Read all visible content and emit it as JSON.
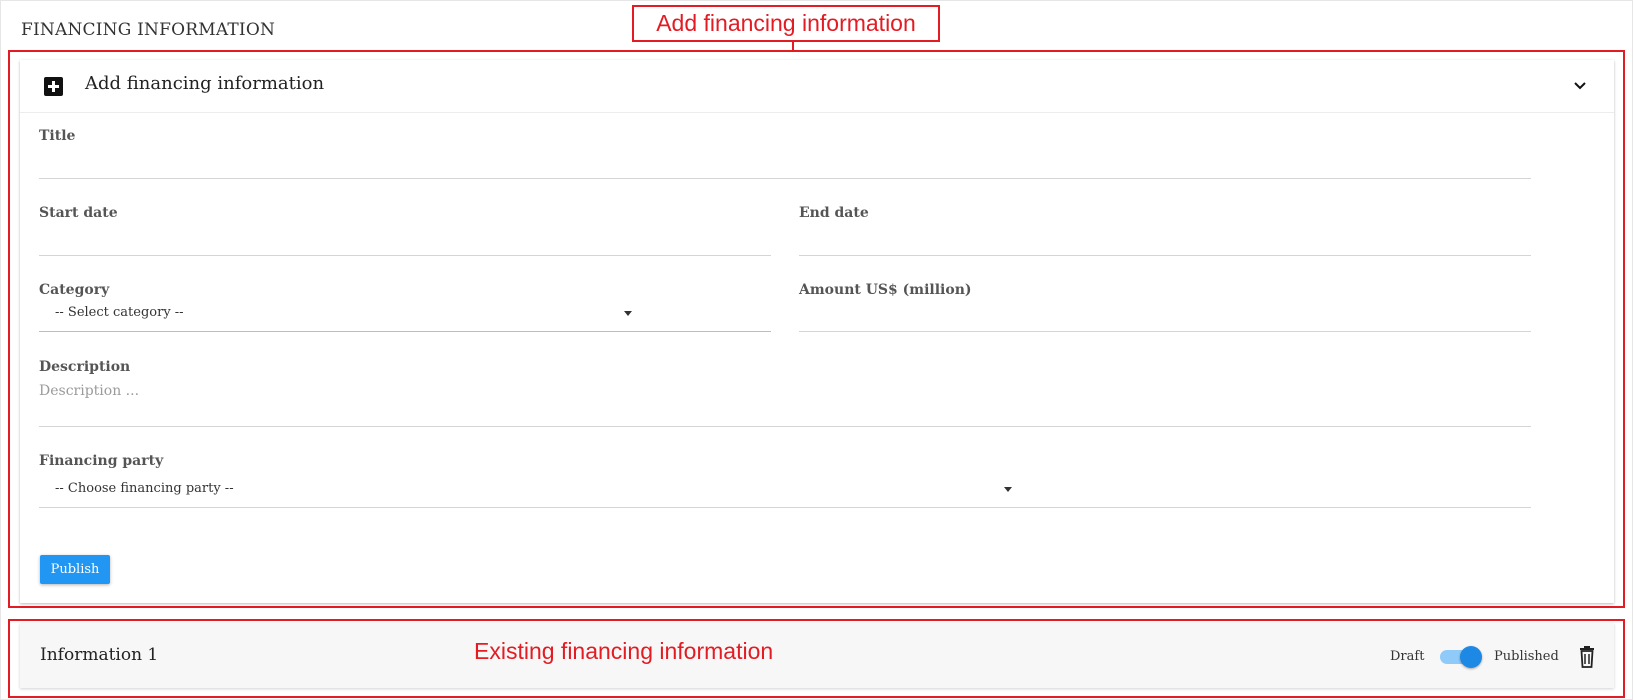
{
  "section": {
    "title": "FINANCING INFORMATION"
  },
  "annotations": {
    "add_label": "Add financing information",
    "existing_label": "Existing financing information",
    "color": "#e31b23"
  },
  "form": {
    "header_title": "Add financing information",
    "expand_icon": "chevron-down-icon",
    "add_icon": "plus-square-icon",
    "title": {
      "label": "Title",
      "value": ""
    },
    "start_date": {
      "label": "Start date",
      "value": ""
    },
    "end_date": {
      "label": "End date",
      "value": ""
    },
    "category": {
      "label": "Category",
      "selected": "-- Select category --"
    },
    "amount": {
      "label": "Amount US$ (million)",
      "value": ""
    },
    "description": {
      "label": "Description",
      "placeholder": "Description ..."
    },
    "financing_party": {
      "label": "Financing party",
      "selected": "-- Choose financing party --"
    },
    "publish_label": "Publish",
    "accent_color": "#2196f3"
  },
  "existing": {
    "items": [
      {
        "title": "Information 1",
        "toggle_off_label": "Draft",
        "toggle_on_label": "Published",
        "published": true,
        "delete_icon": "trash-icon"
      }
    ]
  }
}
